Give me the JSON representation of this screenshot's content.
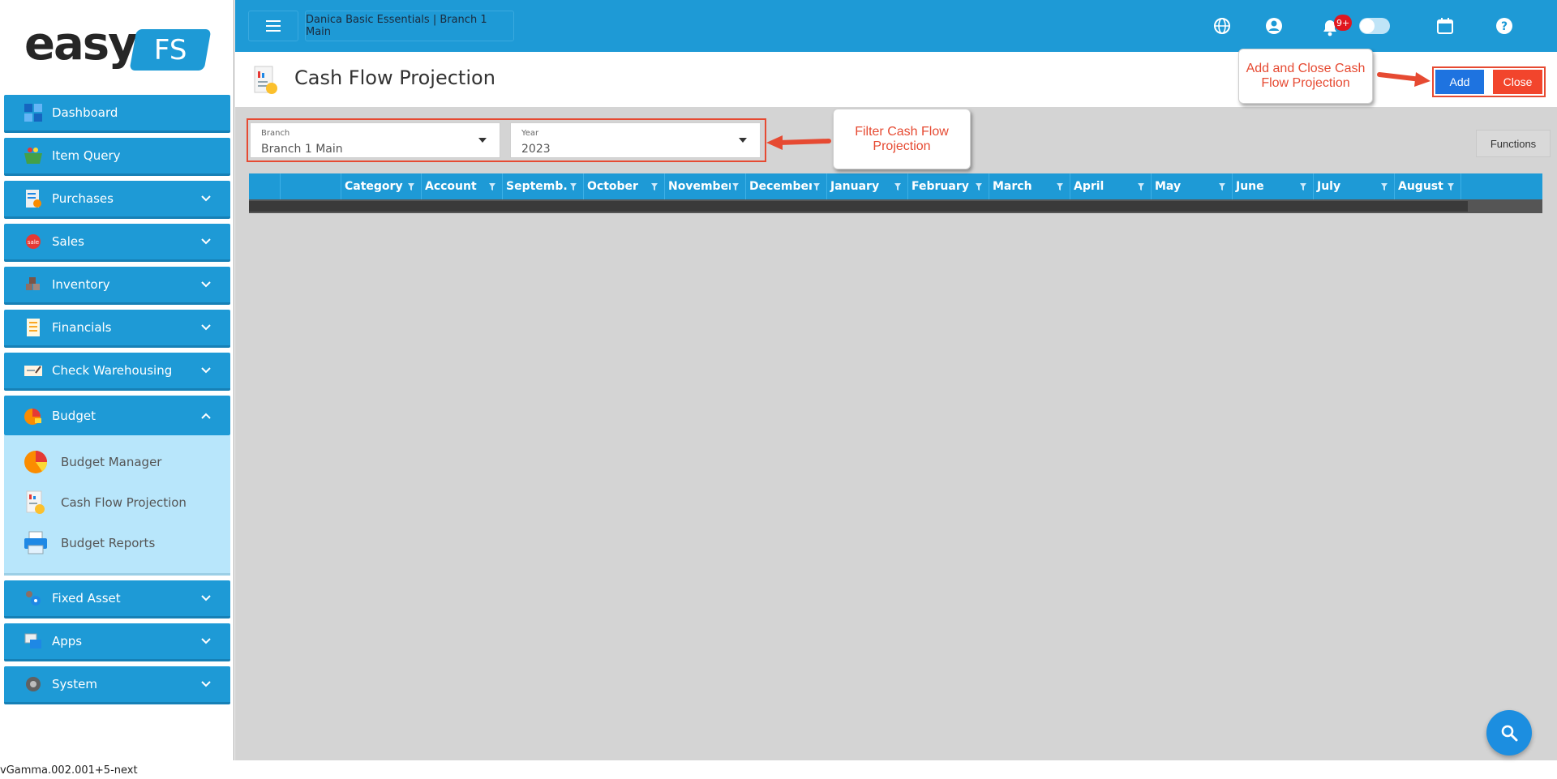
{
  "logo": {
    "word": "easy",
    "badge": "FS"
  },
  "topbar": {
    "company_branch": "Danica Basic Essentials | Branch 1 Main",
    "notification_count": "9+"
  },
  "page": {
    "title": "Cash Flow Projection"
  },
  "actions": {
    "add_label": "Add",
    "close_label": "Close"
  },
  "sidebar": {
    "items": [
      {
        "label": "Dashboard",
        "icon": "dashboard-icon"
      },
      {
        "label": "Item Query",
        "icon": "basket-icon"
      },
      {
        "label": "Purchases",
        "icon": "purchases-icon"
      },
      {
        "label": "Sales",
        "icon": "sales-icon"
      },
      {
        "label": "Inventory",
        "icon": "inventory-icon"
      },
      {
        "label": "Financials",
        "icon": "financials-icon"
      },
      {
        "label": "Check Warehousing",
        "icon": "check-icon"
      },
      {
        "label": "Budget",
        "icon": "budget-icon"
      },
      {
        "label": "Fixed Asset",
        "icon": "fixed-asset-icon"
      },
      {
        "label": "Apps",
        "icon": "apps-icon"
      },
      {
        "label": "System",
        "icon": "system-icon"
      }
    ],
    "budget_sub": [
      {
        "label": "Budget Manager",
        "icon": "pie-chart-icon"
      },
      {
        "label": "Cash Flow Projection",
        "icon": "cash-flow-icon"
      },
      {
        "label": "Budget Reports",
        "icon": "printer-icon"
      }
    ]
  },
  "filters": {
    "branch": {
      "label": "Branch",
      "value": "Branch 1 Main"
    },
    "year": {
      "label": "Year",
      "value": "2023"
    }
  },
  "functions_label": "Functions",
  "grid": {
    "columns": [
      "",
      "",
      "Category",
      "Account",
      "Septemb...",
      "October",
      "November",
      "December",
      "January",
      "February",
      "March",
      "April",
      "May",
      "June",
      "July",
      "August"
    ]
  },
  "callouts": {
    "filter": "Filter Cash Flow Projection",
    "add_close": "Add and Close Cash Flow Projection"
  },
  "version": "vGamma.002.001+5-next",
  "colors": {
    "primary": "#1e9ad6",
    "add": "#1e73e0",
    "close": "#f2452c",
    "annotation": "#e64a32"
  }
}
